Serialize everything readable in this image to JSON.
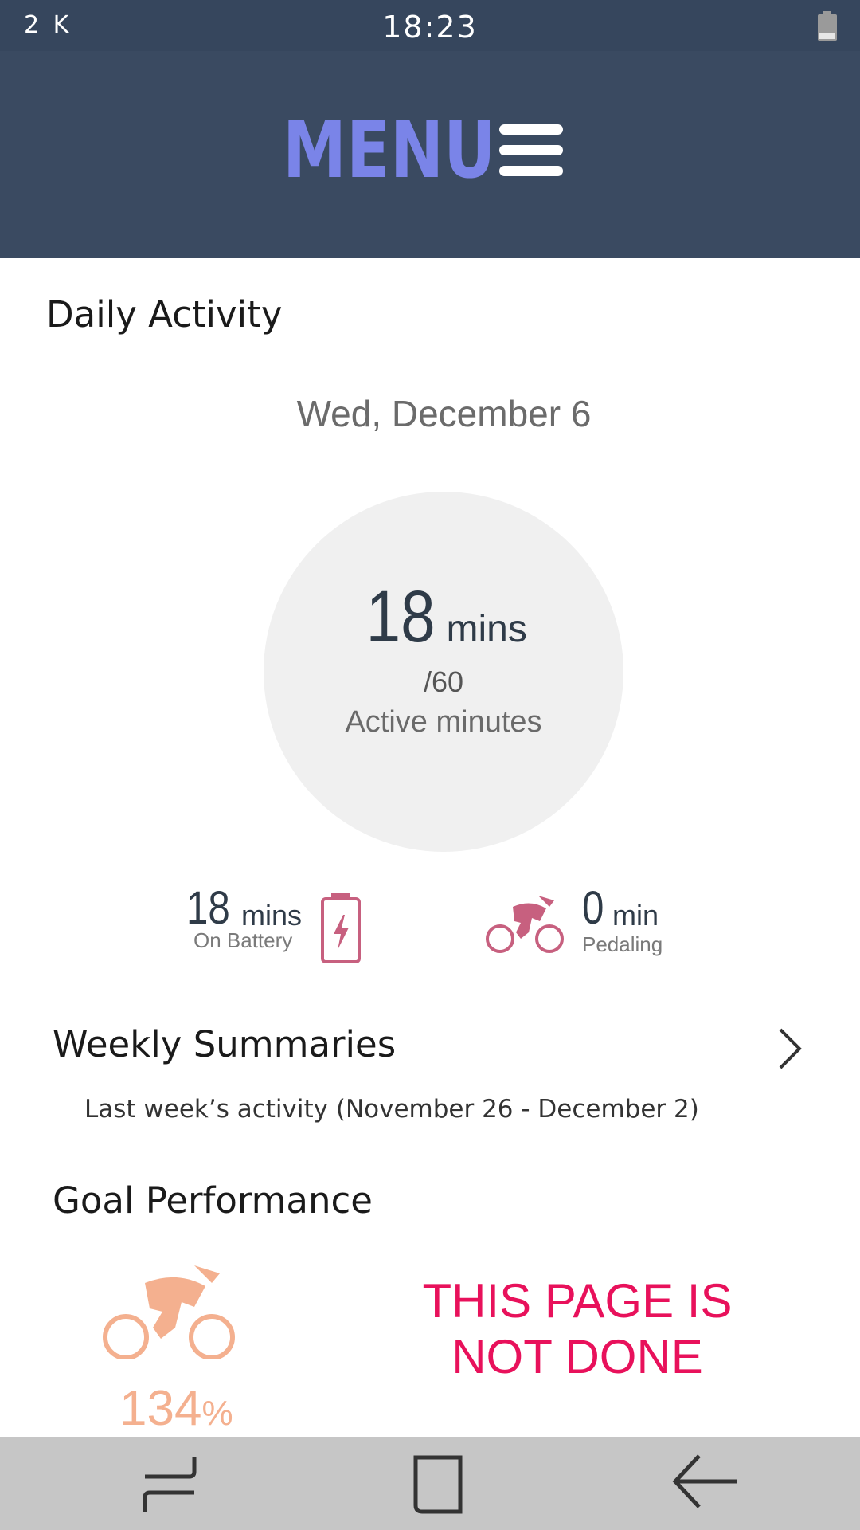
{
  "status_bar": {
    "left_text": "2 K",
    "time": "18:23"
  },
  "header": {
    "menu_label": "MENU",
    "menu_icon": "hamburger-icon"
  },
  "daily_activity": {
    "title": "Daily Activity",
    "date": "Wed, December 6",
    "active_minutes": "18",
    "active_unit": "mins",
    "goal": "/60",
    "label": "Active minutes",
    "progress_fraction": 0.3
  },
  "stats": {
    "battery": {
      "value": "18",
      "unit": "mins",
      "label": "On Battery",
      "icon": "battery-charging-icon"
    },
    "pedaling": {
      "value": "0",
      "unit": "min",
      "label": "Pedaling",
      "icon": "cyclist-icon"
    }
  },
  "weekly": {
    "title": "Weekly Summaries",
    "subtitle": "Last week’s activity (November 26 - December 2)"
  },
  "goal_performance": {
    "title": "Goal Performance",
    "percent_value": "134",
    "percent_sign": "%"
  },
  "notice": {
    "line1": "THIS PAGE IS",
    "line2": "NOT DONE"
  },
  "colors": {
    "header_bg": "#3a4a61",
    "menu_text": "#7a84e8",
    "accent_pink": "#c7607f",
    "accent_peach": "#f4b08f",
    "notice_red": "#e8115b",
    "nav_bg": "#c6c6c6"
  },
  "nav_bar": {
    "recent_icon": "recent-apps-icon",
    "home_icon": "home-icon",
    "back_icon": "back-arrow-icon"
  }
}
